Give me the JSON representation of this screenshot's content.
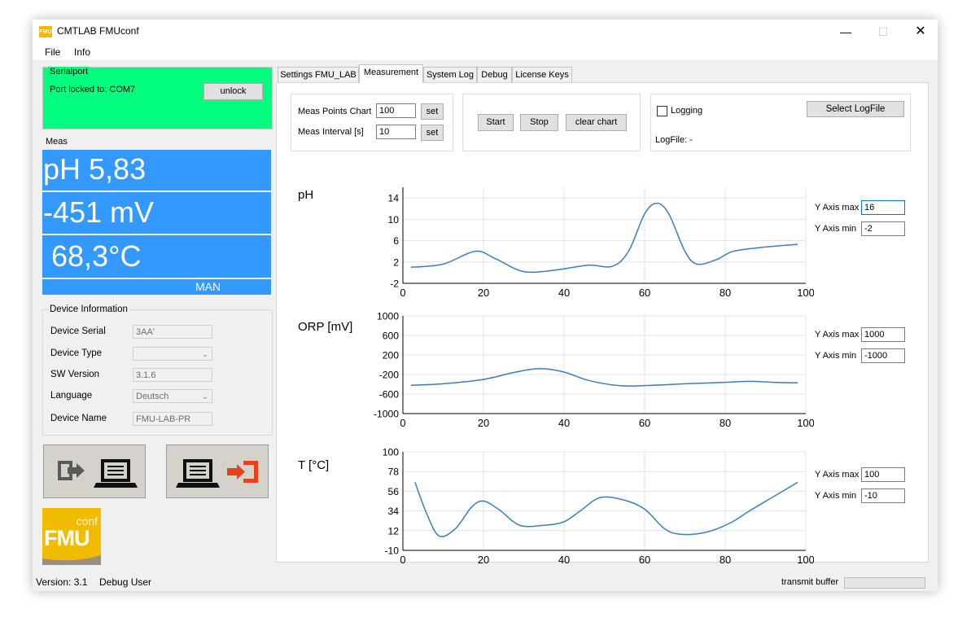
{
  "window": {
    "title": "CMTLAB FMUconf",
    "icon_text": "FMU"
  },
  "menu": [
    "File",
    "Info"
  ],
  "serialport": {
    "group_title": "Serialport",
    "status": "Port locked to: COM7",
    "unlock_label": "unlock"
  },
  "meas": {
    "group_title": "Meas",
    "ph": "pH  5,83",
    "mv": "-451 mV",
    "temp": "68,3°C",
    "mode": "MAN"
  },
  "device_info": {
    "group_title": "Device Information",
    "serial_label": "Device Serial",
    "serial_value": "3AA'",
    "type_label": "Device Type",
    "type_value": "",
    "sw_label": "SW Version",
    "sw_value": "3.1.6",
    "language_label": "Language",
    "language_value": "Deutsch",
    "name_label": "Device Name",
    "name_value": "FMU-LAB-PR"
  },
  "logo": {
    "small": "conf",
    "big": "FMU"
  },
  "tabs": [
    "Settings FMU_LAB",
    "Measurement",
    "System Log",
    "Debug",
    "License Keys"
  ],
  "active_tab": 1,
  "measurement": {
    "points_label": "Meas Points Chart",
    "points_value": "100",
    "set1": "set",
    "interval_label": "Meas Interval [s]",
    "interval_value": "10",
    "set2": "set",
    "start": "Start",
    "stop": "Stop",
    "clear": "clear chart",
    "logging_label": "Logging",
    "select_logfile": "Select LogFile",
    "logfile": "LogFile: -"
  },
  "chart_controls": [
    {
      "max_label": "Y Axis max",
      "max_value": "16",
      "min_label": "Y Axis min",
      "min_value": "-2"
    },
    {
      "max_label": "Y Axis max",
      "max_value": "1000",
      "min_label": "Y Axis min",
      "min_value": "-1000"
    },
    {
      "max_label": "Y Axis max",
      "max_value": "100",
      "min_label": "Y Axis min",
      "min_value": "-10"
    }
  ],
  "chart_data": [
    {
      "type": "line",
      "title": "pH",
      "xlim": [
        0,
        100
      ],
      "ylim": [
        -2,
        16
      ],
      "xticks": [
        0,
        20,
        40,
        60,
        80,
        100
      ],
      "yticks": [
        -2,
        2,
        6,
        10,
        14
      ],
      "color": "#3a7dc0",
      "grid": true,
      "x": [
        2,
        10,
        18,
        23,
        30,
        38,
        46,
        52,
        56,
        60,
        63,
        66,
        70,
        73,
        78,
        82,
        90,
        98
      ],
      "y": [
        1.0,
        1.6,
        4.0,
        2.6,
        0.2,
        0.5,
        1.4,
        1.2,
        4.0,
        11.0,
        13.0,
        11.0,
        4.0,
        1.6,
        2.5,
        4.0,
        4.8,
        5.3
      ]
    },
    {
      "type": "line",
      "title": "ORP [mV]",
      "xlim": [
        0,
        100
      ],
      "ylim": [
        -1000,
        1000
      ],
      "xticks": [
        0,
        20,
        40,
        60,
        80,
        100
      ],
      "yticks": [
        -1000,
        -600,
        -200,
        200,
        600,
        1000
      ],
      "color": "#3a7dc0",
      "grid": true,
      "x": [
        2,
        10,
        20,
        28,
        34,
        40,
        46,
        54,
        62,
        70,
        80,
        86,
        92,
        98
      ],
      "y": [
        -420,
        -390,
        -300,
        -150,
        -80,
        -150,
        -320,
        -430,
        -420,
        -390,
        -360,
        -340,
        -360,
        -370
      ]
    },
    {
      "type": "line",
      "title": "T [°C]",
      "xlim": [
        0,
        100
      ],
      "ylim": [
        -10,
        100
      ],
      "xticks": [
        0,
        20,
        40,
        60,
        80,
        100
      ],
      "yticks": [
        -10,
        12,
        34,
        56,
        78,
        100
      ],
      "color": "#3a7dc0",
      "grid": true,
      "x": [
        3,
        6,
        9,
        13,
        17,
        20,
        24,
        29,
        35,
        40,
        44,
        49,
        55,
        60,
        65,
        69,
        75,
        81,
        86,
        92,
        98
      ],
      "y": [
        66,
        30,
        6,
        14,
        38,
        45,
        35,
        18,
        18,
        22,
        34,
        49,
        46,
        36,
        14,
        8,
        10,
        20,
        34,
        50,
        66
      ]
    }
  ],
  "status": {
    "version": "Version: 3.1",
    "user": "Debug User",
    "transmit": "transmit buffer"
  }
}
